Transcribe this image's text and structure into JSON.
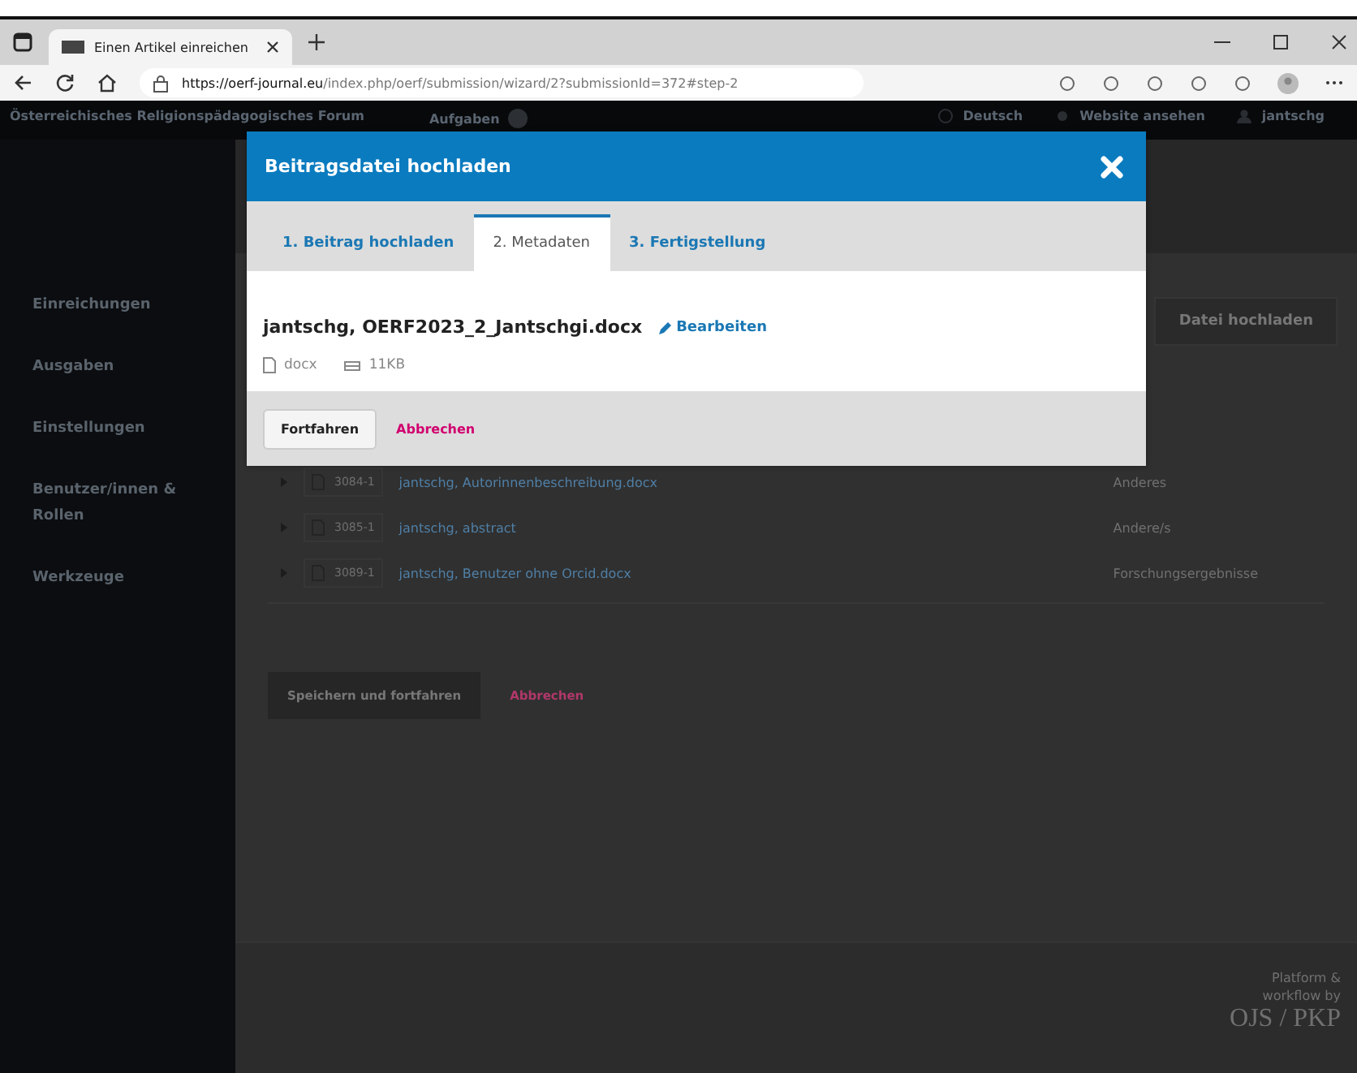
{
  "browser": {
    "tab_title": "Einen Artikel einreichen",
    "url_host": "https://oerf-journal.eu",
    "url_path": "/index.php/oerf/submission/wizard/2?submissionId=372#step-2"
  },
  "header": {
    "site_title": "Österreichisches Religionspädagogisches Forum",
    "tasks": "Aufgaben",
    "language": "Deutsch",
    "view_site": "Website ansehen",
    "user": "jantschg"
  },
  "sidebar": {
    "items": [
      {
        "label": "Einreichungen"
      },
      {
        "label": "Ausgaben"
      },
      {
        "label": "Einstellungen"
      },
      {
        "label": "Benutzer/innen & Rollen"
      },
      {
        "label": "Werkzeuge"
      }
    ]
  },
  "main": {
    "upload_button": "Datei hochladen",
    "files": [
      {
        "id": "3084-1",
        "name": "jantschg, Autorinnenbeschreibung.docx",
        "type": "Anderes"
      },
      {
        "id": "3085-1",
        "name": "jantschg, abstract",
        "type": "Andere/s"
      },
      {
        "id": "3089-1",
        "name": "jantschg, Benutzer ohne Orcid.docx",
        "type": "Forschungsergebnisse"
      }
    ],
    "save_button": "Speichern und fortfahren",
    "cancel_link": "Abbrechen"
  },
  "footer": {
    "line_1": "Platform &",
    "line_2": "workflow by",
    "logo": "OJS / PKP"
  },
  "modal": {
    "title": "Beitragsdatei hochladen",
    "tabs": [
      {
        "label": "1. Beitrag hochladen",
        "selected": false
      },
      {
        "label": "2. Metadaten",
        "selected": true
      },
      {
        "label": "3. Fertigstellung",
        "selected": false
      }
    ],
    "file": {
      "name": "jantschg, OERF2023_2_Jantschgi.docx",
      "edit_link": "Bearbeiten",
      "format": "docx",
      "size": "11KB"
    },
    "continue_button": "Fortfahren",
    "cancel_link": "Abbrechen"
  }
}
